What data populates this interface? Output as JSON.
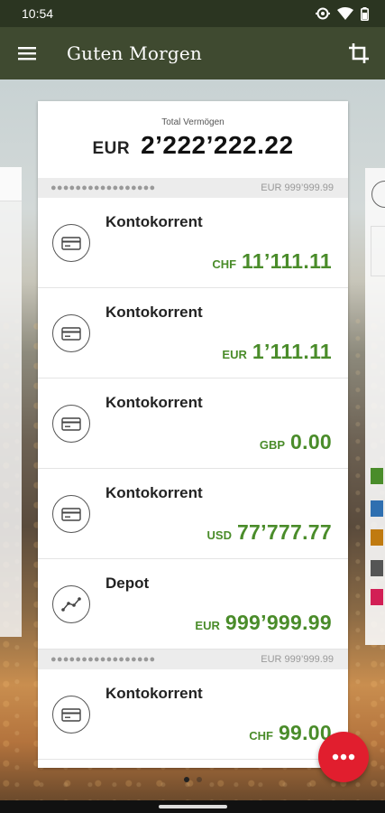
{
  "status": {
    "time": "10:54"
  },
  "appbar": {
    "title": "Guten Morgen"
  },
  "summary": {
    "label": "Total Vermögen",
    "currency": "EUR",
    "amount": "2’222’222.22"
  },
  "groups": [
    {
      "masked_name": "●●●●●●●●●●●●●●●●●",
      "total": "EUR 999’999.99",
      "accounts": [
        {
          "name": "Kontokorrent",
          "currency": "CHF",
          "amount": "11’111.11",
          "icon": "card-icon"
        },
        {
          "name": "Kontokorrent",
          "currency": "EUR",
          "amount": "1’111.11",
          "icon": "card-icon"
        },
        {
          "name": "Kontokorrent",
          "currency": "GBP",
          "amount": "0.00",
          "icon": "card-icon"
        },
        {
          "name": "Kontokorrent",
          "currency": "USD",
          "amount": "77’777.77",
          "icon": "card-icon"
        },
        {
          "name": "Depot",
          "currency": "EUR",
          "amount": "999’999.99",
          "icon": "chart-line-icon"
        }
      ]
    },
    {
      "masked_name": "●●●●●●●●●●●●●●●●●",
      "total": "EUR 999’999.99",
      "accounts": [
        {
          "name": "Kontokorrent",
          "currency": "CHF",
          "amount": "99.00",
          "icon": "card-icon"
        }
      ]
    }
  ],
  "colors": {
    "appbar": "#3f4a30",
    "statusbar": "#2b3521",
    "amount_green": "#4a8c2a",
    "fab_red": "#e11e2e"
  },
  "pager": {
    "pages": 2,
    "active": 1
  }
}
